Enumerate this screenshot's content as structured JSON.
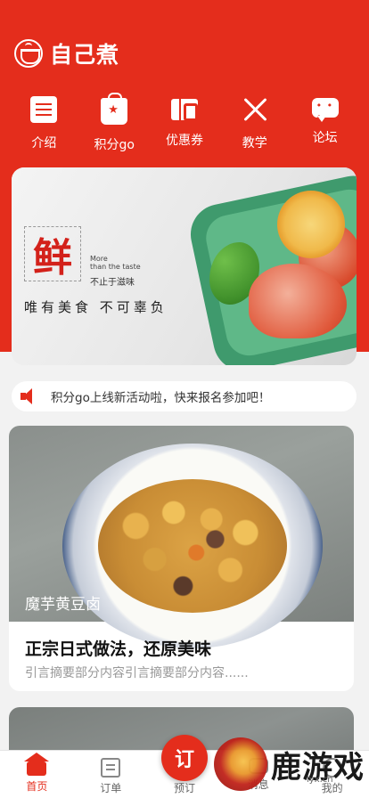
{
  "app": {
    "title": "自己煮"
  },
  "nav": [
    {
      "label": "介绍",
      "icon": "document-icon"
    },
    {
      "label": "积分go",
      "icon": "shopping-bag-icon"
    },
    {
      "label": "优惠券",
      "icon": "coupon-icon"
    },
    {
      "label": "教学",
      "icon": "fork-knife-icon"
    },
    {
      "label": "论坛",
      "icon": "chat-icon"
    }
  ],
  "banner": {
    "big_char": "鲜",
    "more_line1": "More",
    "more_line2": "than the taste",
    "sub": "不止于滋味",
    "slogan": "唯有美食 不可辜负"
  },
  "notice": {
    "text": "积分go上线新活动啦，快来报名参加吧！",
    "icon": "speaker-icon"
  },
  "articles": [
    {
      "caption": "魔芋黄豆卤",
      "title": "正宗日式做法，还原美味",
      "desc": "引言摘要部分内容引言摘要部分内容......"
    }
  ],
  "tabbar": {
    "items": [
      {
        "label": "首页",
        "active": true
      },
      {
        "label": "订单"
      },
      {
        "label": "预订"
      },
      {
        "label": "消息"
      },
      {
        "label": "我的"
      }
    ],
    "fab": "订"
  },
  "watermark": {
    "text": "鹿游戏",
    "url": "lyx.cn"
  },
  "colors": {
    "primary": "#e42d1c",
    "background": "#f2f2f2"
  }
}
